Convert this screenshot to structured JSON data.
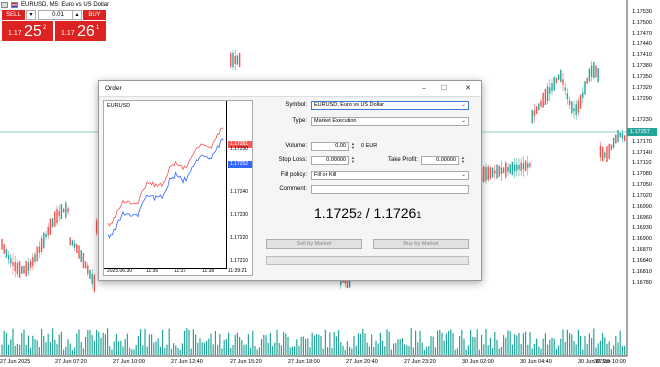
{
  "symbol_bar": {
    "text": "EURUSD, M5:  Euro vs US Dollar"
  },
  "one_click": {
    "sell_label": "SELL",
    "buy_label": "BUY",
    "volume": "0.01",
    "arrow_down": "▾",
    "arrow_up": "▴",
    "sell_price": {
      "prefix": "1.17",
      "big": "25",
      "sup": "2"
    },
    "buy_price": {
      "prefix": "1.17",
      "big": "26",
      "sup": "1"
    }
  },
  "price_axis": {
    "labels": [
      "1.17530",
      "1.17500",
      "1.17470",
      "1.17440",
      "1.17410",
      "1.17380",
      "1.17350",
      "1.17320",
      "1.17290",
      "1.17257",
      "1.17230",
      "1.17200",
      "1.17170",
      "1.17140",
      "1.17110",
      "1.17080",
      "1.17050",
      "1.17020",
      "1.16990",
      "1.16960",
      "1.16930",
      "1.16900",
      "1.16870",
      "1.16840",
      "1.16810",
      "1.16780"
    ],
    "current": "1.17257"
  },
  "time_axis": {
    "labels": [
      "27 Jun 2025",
      "27 Jun 07:20",
      "27 Jun 10:00",
      "27 Jun 12:40",
      "27 Jun 15:20",
      "27 Jun 18:00",
      "27 Jun 20:40",
      "27 Jun 23:20",
      "30 Jun 02:00",
      "30 Jun 04:40",
      "30 Jun 07:20",
      "30 Jun 10:00"
    ]
  },
  "dialog": {
    "title": "Order",
    "controls": {
      "minimize": "–",
      "maximize": "☐",
      "close": "✕"
    },
    "mini_chart": {
      "symbol": "EURUSD",
      "ask_tag": "1.17261",
      "bid_tag": "1.17252",
      "y_ticks": [
        "1.17250",
        "1.17240",
        "1.17230",
        "1.17220",
        "1.17210"
      ],
      "x_ticks": [
        "2025.06.30",
        "11:36",
        "11:37",
        "11:38",
        "11:39:21"
      ]
    },
    "form": {
      "symbol_label": "Symbol:",
      "symbol_value": "EURUSD, Euro vs US Dollar",
      "type_label": "Type:",
      "type_value": "Market Execution",
      "volume_label": "Volume:",
      "volume_value": "0.00",
      "volume_unit": "0 EUR",
      "sl_label": "Stop Loss:",
      "sl_value": "0.00000",
      "tp_label": "Take Profit:",
      "tp_value": "0.00000",
      "fill_label": "Fill policy:",
      "fill_value": "Fill or Kill",
      "comment_label": "Comment:",
      "comment_value": ""
    },
    "quote": {
      "bid_main": "1.1725",
      "bid_sub": "2",
      "sep": " / ",
      "ask_main": "1.1726",
      "ask_sub": "1"
    },
    "sell_button": "Sell by Market",
    "buy_button": "Buy by Market"
  },
  "colors": {
    "bull": "#26a69a",
    "bear": "#ef5350",
    "volume": "#26a69a",
    "one_click_red": "#dd2222",
    "ask_line": "#f55555",
    "bid_line": "#3366ff"
  }
}
